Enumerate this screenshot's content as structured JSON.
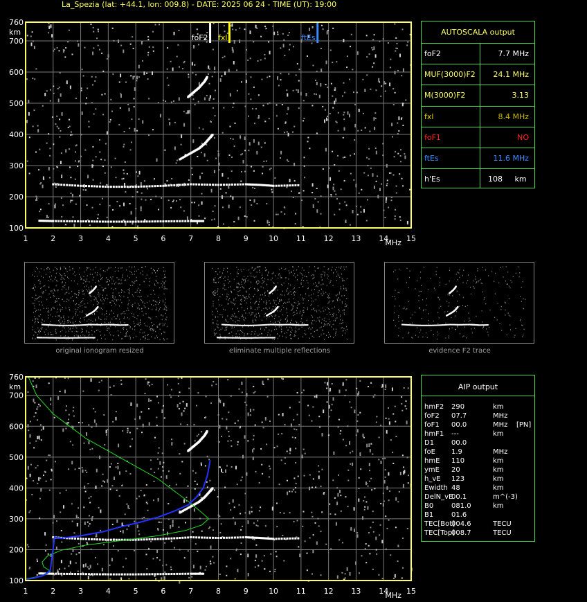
{
  "header": {
    "title": "La_Spezia (lat: +44.1, lon: 009.8) - DATE: 2025 06 24 - TIME (UT): 19:00"
  },
  "autoscala": {
    "heading": "AUTOSCALA output",
    "rows": [
      {
        "label": "foF2",
        "value": "7.7 MHz",
        "color": "#ffffff"
      },
      {
        "label": "MUF(3000)F2",
        "value": "24.1 MHz",
        "color": "#ffff66"
      },
      {
        "label": "M(3000)F2",
        "value": "3.13",
        "color": "#ffff66"
      },
      {
        "label": "fxl",
        "value": "8.4 MHz",
        "color": "#e8d800",
        "valueColor": "#c8b800"
      },
      {
        "label": "foF1",
        "value": "NO",
        "color": "#ff2020"
      },
      {
        "label": "ftEs",
        "value": "11.6 MHz",
        "color": "#3a8cff"
      },
      {
        "label": "h'Es",
        "value": "108     km",
        "color": "#ffffff"
      }
    ]
  },
  "thumbnails": {
    "captions": [
      "original ionogram resized",
      "eliminate multiple reflections",
      "evidence F2 trace"
    ]
  },
  "aip": {
    "heading": "AIP output",
    "rows": [
      [
        "hmF2",
        "290",
        "km",
        ""
      ],
      [
        "foF2",
        "07.7",
        "MHz",
        ""
      ],
      [
        "foF1",
        "00.0",
        "MHz",
        "[PN]"
      ],
      [
        "hmF1",
        "---",
        "km",
        ""
      ],
      [
        "D1",
        "00.0",
        "",
        ""
      ],
      [
        "foE",
        "1.9",
        "MHz",
        ""
      ],
      [
        "hmE",
        "110",
        "km",
        ""
      ],
      [
        "ymE",
        "20",
        "km",
        ""
      ],
      [
        "h_vE",
        "123",
        "km",
        ""
      ],
      [
        "Ewidth",
        "48",
        "km",
        ""
      ],
      [
        "DelN_vE",
        "00.1",
        "m^(-3)",
        ""
      ],
      [
        "B0",
        "081.0",
        "km",
        ""
      ],
      [
        "B1",
        "01.6",
        "",
        ""
      ],
      [
        "TEC[Bot]",
        "004.6",
        "TECU",
        ""
      ],
      [
        "TEC[Top]",
        "008.7",
        "TECU",
        ""
      ]
    ]
  },
  "chart_data": [
    {
      "type": "scatter",
      "name": "ionogram-top",
      "xlabel": "MHz",
      "ylabel": "km",
      "xlim": [
        1,
        15
      ],
      "ylim": [
        100,
        760
      ],
      "xticks": [
        1,
        2,
        3,
        4,
        5,
        6,
        7,
        8,
        9,
        10,
        11,
        12,
        13,
        14,
        15
      ],
      "yticks": [
        100,
        200,
        300,
        400,
        500,
        600,
        700,
        760
      ],
      "markers": [
        {
          "label": "foF2",
          "x": 7.7,
          "color": "#ffffff"
        },
        {
          "label": "fxl",
          "x": 8.4,
          "color": "#ffff00"
        },
        {
          "label": "ftEs",
          "x": 11.6,
          "color": "#3a8cff"
        }
      ],
      "traces": {
        "F2_lower": [
          [
            6.6,
            320
          ],
          [
            7.0,
            340
          ],
          [
            7.3,
            355
          ],
          [
            7.5,
            370
          ],
          [
            7.7,
            390
          ],
          [
            7.8,
            400
          ]
        ],
        "F2_upper": [
          [
            6.9,
            520
          ],
          [
            7.1,
            535
          ],
          [
            7.3,
            550
          ],
          [
            7.5,
            570
          ],
          [
            7.6,
            585
          ]
        ],
        "Es": [
          [
            1.5,
            123
          ],
          [
            2,
            122
          ],
          [
            3,
            121
          ],
          [
            4,
            120
          ],
          [
            5,
            120
          ],
          [
            6,
            121
          ],
          [
            7,
            122
          ],
          [
            7.5,
            122
          ]
        ],
        "E2": [
          [
            2,
            240
          ],
          [
            3,
            235
          ],
          [
            4,
            232
          ],
          [
            5,
            232
          ],
          [
            6,
            235
          ],
          [
            7,
            240
          ],
          [
            8,
            238
          ],
          [
            9,
            240
          ],
          [
            9.5,
            238
          ],
          [
            10,
            235
          ],
          [
            11,
            237
          ]
        ]
      }
    },
    {
      "type": "line",
      "name": "ionogram-aip",
      "xlabel": "MHz",
      "ylabel": "km",
      "xlim": [
        1,
        15
      ],
      "ylim": [
        100,
        760
      ],
      "xticks": [
        1,
        2,
        3,
        4,
        5,
        6,
        7,
        8,
        9,
        10,
        11,
        12,
        13,
        14,
        15
      ],
      "yticks": [
        100,
        200,
        300,
        400,
        500,
        600,
        700,
        760
      ],
      "series": [
        {
          "color": "#22dd22",
          "points": [
            [
              1.1,
              760
            ],
            [
              1.4,
              700
            ],
            [
              2,
              640
            ],
            [
              2.6,
              600
            ],
            [
              3.2,
              560
            ],
            [
              4,
              520
            ],
            [
              5,
              470
            ],
            [
              5.8,
              430
            ],
            [
              6.4,
              390
            ],
            [
              7,
              350
            ],
            [
              7.4,
              320
            ],
            [
              7.65,
              300
            ],
            [
              7.4,
              280
            ],
            [
              6.8,
              262
            ],
            [
              5.8,
              245
            ],
            [
              4.5,
              230
            ],
            [
              3.2,
              215
            ],
            [
              2.3,
              198
            ],
            [
              1.8,
              180
            ],
            [
              1.6,
              160
            ],
            [
              1.65,
              145
            ],
            [
              1.9,
              130
            ],
            [
              1.7,
              118
            ],
            [
              1.3,
              110
            ],
            [
              1.0,
              105
            ]
          ]
        },
        {
          "color": "#2233ff",
          "points": [
            [
              1.0,
              103
            ],
            [
              1.3,
              108
            ],
            [
              1.6,
              115
            ],
            [
              1.8,
              125
            ],
            [
              1.9,
              135
            ],
            [
              2.05,
              240
            ],
            [
              2.3,
              237
            ],
            [
              3,
              245
            ],
            [
              3.8,
              258
            ],
            [
              4.5,
              275
            ],
            [
              5.2,
              290
            ],
            [
              5.8,
              305
            ],
            [
              6.4,
              325
            ],
            [
              6.9,
              345
            ],
            [
              7.2,
              370
            ],
            [
              7.45,
              400
            ],
            [
              7.6,
              440
            ],
            [
              7.7,
              490
            ]
          ]
        }
      ]
    }
  ]
}
